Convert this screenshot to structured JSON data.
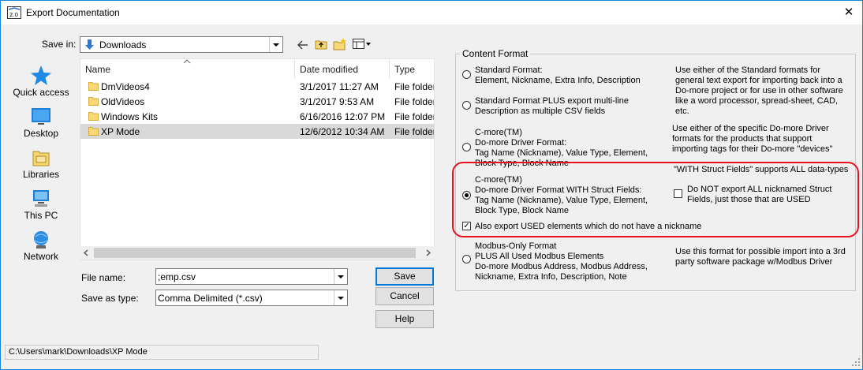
{
  "window": {
    "title": "Export Documentation",
    "close_glyph": "✕"
  },
  "save_in": {
    "label": "Save in:",
    "value": "Downloads"
  },
  "places": [
    {
      "label": "Quick access",
      "icon": "quick-access-star-icon"
    },
    {
      "label": "Desktop",
      "icon": "desktop-icon"
    },
    {
      "label": "Libraries",
      "icon": "libraries-icon"
    },
    {
      "label": "This PC",
      "icon": "this-pc-icon"
    },
    {
      "label": "Network",
      "icon": "network-icon"
    }
  ],
  "file_list": {
    "columns": [
      "Name",
      "Date modified",
      "Type"
    ],
    "rows": [
      {
        "name": "DmVideos4",
        "date": "3/1/2017 11:27 AM",
        "type": "File folder"
      },
      {
        "name": "OldVideos",
        "date": "3/1/2017 9:53 AM",
        "type": "File folder"
      },
      {
        "name": "Windows Kits",
        "date": "6/16/2016 12:07 PM",
        "type": "File folder"
      },
      {
        "name": "XP Mode",
        "date": "12/6/2012 10:34 AM",
        "type": "File folder",
        "selected": true
      }
    ]
  },
  "file_name": {
    "label": "File name:",
    "value": ";emp.csv"
  },
  "save_as_type": {
    "label": "Save as type:",
    "value": "Comma Delimited (*.csv)"
  },
  "buttons": {
    "save": "Save",
    "cancel": "Cancel",
    "help": "Help"
  },
  "status_path": "C:\\Users\\mark\\Downloads\\XP Mode",
  "content_format": {
    "title": "Content Format",
    "options": [
      {
        "lines": [
          "Standard Format:",
          "Element, Nickname, Extra Info, Description"
        ],
        "selected": false
      },
      {
        "lines": [
          "Standard Format PLUS export multi-line",
          "Description as multiple CSV fields"
        ],
        "selected": false
      },
      {
        "lines": [
          "C-more(TM)",
          "Do-more Driver Format:",
          "Tag Name (Nickname), Value Type, Element,",
          "Block Type, Block Name"
        ],
        "selected": false
      },
      {
        "lines": [
          "C-more(TM)",
          "Do-more Driver Format WITH Struct Fields:",
          "Tag Name (Nickname), Value Type, Element,",
          "Block Type, Block Name"
        ],
        "selected": true
      },
      {
        "lines": [
          "Modbus-Only Format",
          "PLUS All Used Modbus Elements",
          "Do-more Modbus Address, Modbus Address,",
          "Nickname, Extra Info, Description, Note"
        ],
        "selected": false
      }
    ],
    "descriptions": {
      "standard": "Use either of the Standard formats for general text export for importing back into a Do-more project or for use in other software like a word processor, spread-sheet, CAD, etc.",
      "driver": "Use either of the specific Do-more Driver formats for the products that support importing tags for their Do-more \"devices\"",
      "struct_note": "\"WITH Struct Fields\" supports ALL data-types",
      "modbus": "Use this format for possible import into a 3rd party software package w/Modbus Driver"
    },
    "no_export_nicknamed": {
      "label": "Do NOT export ALL nicknamed Struct Fields, just those that are USED",
      "checked": false
    },
    "export_used": {
      "label": "Also export USED elements which do not have a nickname",
      "checked": true
    }
  },
  "colors": {
    "accent": "#0078d7",
    "highlight": "#e81123",
    "selection": "#d9d9d9",
    "folder": "#f8d775"
  }
}
